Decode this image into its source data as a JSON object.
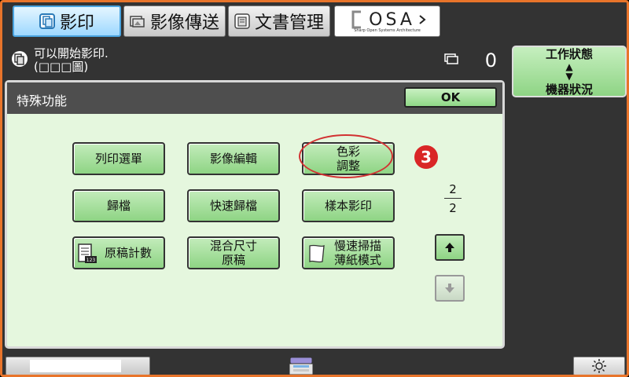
{
  "tabs": [
    {
      "label": "影印",
      "icon": "copy-icon"
    },
    {
      "label": "影像傳送",
      "icon": "image-send-icon"
    },
    {
      "label": "文書管理",
      "icon": "document-filing-icon"
    },
    {
      "label": "OSA",
      "icon": "osa-logo"
    }
  ],
  "osa": {
    "logo_text": "OSA",
    "subtitle": "Sharp Open Systems Architecture"
  },
  "status": {
    "line1": "可以開始影印.",
    "line2": "(□□□圖)",
    "copies": "0"
  },
  "job_status": {
    "line1": "工作狀態",
    "line2": "機器狀況"
  },
  "panel": {
    "title": "特殊功能",
    "ok_label": "OK",
    "buttons": {
      "print_list": "列印選單",
      "image_edit": "影像編輯",
      "color_adjust_l1": "色彩",
      "color_adjust_l2": "調整",
      "filing": "歸檔",
      "quick_filing": "快速歸檔",
      "proof_copy": "樣本影印",
      "original_count": "原稿計數",
      "mixed_size_l1": "混合尺寸",
      "mixed_size_l2": "原稿",
      "slow_scan_l1": "慢速掃描",
      "slow_scan_l2": "薄紙模式"
    },
    "step_number": "3",
    "page": {
      "current": "2",
      "total": "2"
    }
  },
  "colors": {
    "accent_border": "#e8742a",
    "button_green": "#8ed484",
    "panel_bg": "#e5f7de",
    "active_tab": "#9ed8ff",
    "highlight": "#d23232"
  }
}
